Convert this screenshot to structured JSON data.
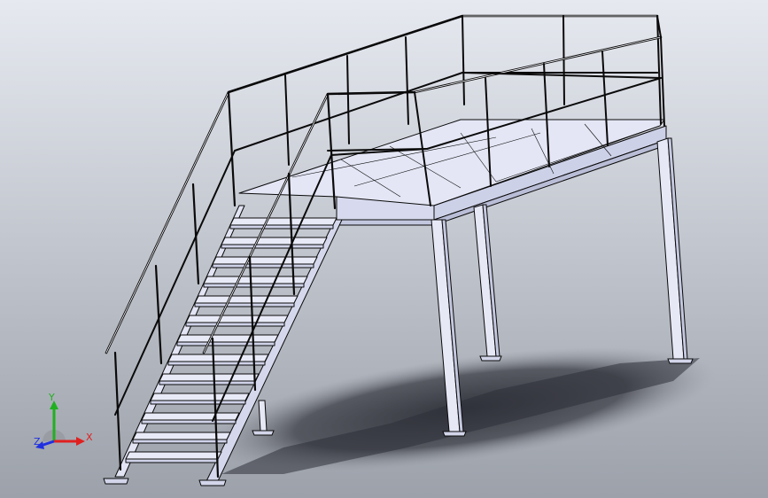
{
  "viewport": {
    "background_top": "#e6e9f0",
    "background_bottom": "#9ca1aa"
  },
  "model": {
    "line_color": "#0a0a0a",
    "surface_light": "#eef0fa",
    "surface_mid": "#d9dcee",
    "surface_dark": "#b9bdd6",
    "shadow_color": "#2e3038"
  },
  "triad": {
    "x_label": "X",
    "y_label": "Y",
    "z_label": "Z",
    "x_color": "#e02020",
    "y_color": "#20b020",
    "z_color": "#2030e0"
  }
}
